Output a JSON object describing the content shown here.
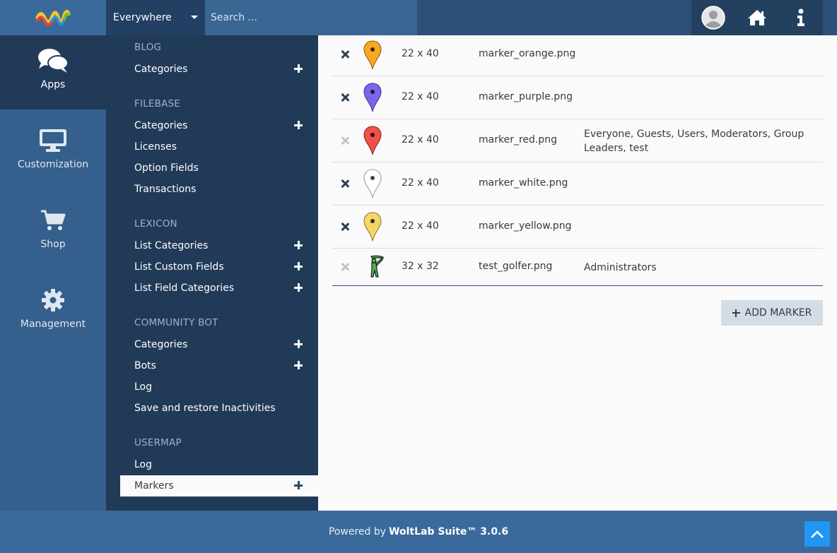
{
  "header": {
    "search_scope": "Everywhere",
    "search_placeholder": "Search ..."
  },
  "apps": [
    {
      "label": "Apps",
      "icon": "chat-bubbles-icon",
      "active": true
    },
    {
      "label": "Customization",
      "icon": "monitor-icon",
      "active": false
    },
    {
      "label": "Shop",
      "icon": "shopping-cart-icon",
      "active": false
    },
    {
      "label": "Management",
      "icon": "gear-icon",
      "active": false
    }
  ],
  "menu": {
    "blog": {
      "title": "BLOG",
      "items": [
        "Categories"
      ]
    },
    "filebase": {
      "title": "FILEBASE",
      "items": [
        "Categories",
        "Licenses",
        "Option Fields",
        "Transactions"
      ]
    },
    "lexicon": {
      "title": "LEXICON",
      "items": [
        "List Categories",
        "List Custom Fields",
        "List Field Categories"
      ]
    },
    "community_bot": {
      "title": "COMMUNITY BOT",
      "items": [
        "Categories",
        "Bots",
        "Log",
        "Save and restore Inactivities"
      ]
    },
    "usermap": {
      "title": "USERMAP",
      "items": [
        "Log",
        "Markers"
      ]
    }
  },
  "markers": [
    {
      "size": "22 x 40",
      "filename": "marker_orange.png",
      "groups": "",
      "deletable": true,
      "color": "#f6a821"
    },
    {
      "size": "22 x 40",
      "filename": "marker_purple.png",
      "groups": "",
      "deletable": true,
      "color": "#7b66e8"
    },
    {
      "size": "22 x 40",
      "filename": "marker_red.png",
      "groups": "Everyone, Guests, Users, Moderators, Group Leaders, test",
      "deletable": false,
      "color": "#ee5149"
    },
    {
      "size": "22 x 40",
      "filename": "marker_white.png",
      "groups": "",
      "deletable": true,
      "color": "#ffffff"
    },
    {
      "size": "22 x 40",
      "filename": "marker_yellow.png",
      "groups": "",
      "deletable": true,
      "color": "#f2d66a"
    },
    {
      "size": "32 x 32",
      "filename": "test_golfer.png",
      "groups": "Administrators",
      "deletable": false,
      "color": "#4caf50"
    }
  ],
  "actions": {
    "add_marker": "ADD MARKER"
  },
  "footer": {
    "powered_by": "Powered by",
    "product": "WoltLab Suite™ 3.0.6"
  },
  "colors": {
    "header": "#2c5079",
    "sidebar_menu": "#213a58",
    "app_column": "#355f8c",
    "footer": "#3a6a9c",
    "scroll_top": "#2196f3"
  }
}
